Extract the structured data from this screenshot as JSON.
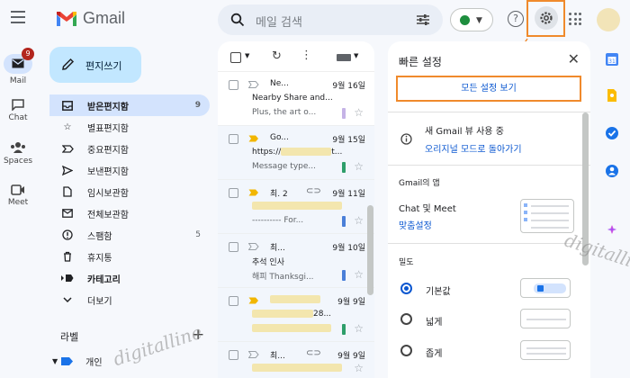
{
  "header": {
    "app_name": "Gmail",
    "search_placeholder": "메일 검색"
  },
  "rail": {
    "mail_label": "Mail",
    "mail_badge": "9",
    "chat_label": "Chat",
    "spaces_label": "Spaces",
    "meet_label": "Meet"
  },
  "compose": {
    "label": "편지쓰기"
  },
  "folders": [
    {
      "label": "받은편지함",
      "count": "9",
      "icon": "inbox-icon"
    },
    {
      "label": "별표편지함",
      "count": "",
      "icon": "star-icon"
    },
    {
      "label": "중요편지함",
      "count": "",
      "icon": "important-icon"
    },
    {
      "label": "보낸편지함",
      "count": "",
      "icon": "send-icon"
    },
    {
      "label": "임시보관함",
      "count": "",
      "icon": "draft-icon"
    },
    {
      "label": "전체보관함",
      "count": "",
      "icon": "all-mail-icon"
    },
    {
      "label": "스팸함",
      "count": "5",
      "icon": "spam-icon"
    },
    {
      "label": "휴지통",
      "count": "",
      "icon": "trash-icon"
    },
    {
      "label": "카테고리",
      "count": "",
      "icon": "category-icon"
    },
    {
      "label": "더보기",
      "count": "",
      "icon": "chevron-down-icon"
    }
  ],
  "labels": {
    "heading": "라벨",
    "items": [
      {
        "label": "개인"
      }
    ]
  },
  "mails": [
    {
      "sender": "Ne...",
      "date": "9월 16일",
      "subject": "Nearby Share and...",
      "snippet": "Plus, the art o...",
      "tag_color": "#c5b3e6"
    },
    {
      "sender": "Go...",
      "date": "9월 15일",
      "subject": "https://",
      "subject_tail": "t...",
      "snippet": "Message type...",
      "tag_color": "#2e9e6a"
    },
    {
      "sender": "최. 2",
      "date": "9월 11일",
      "subject": "",
      "snippet": "---------- For...",
      "tag_color": "#4a7fd8"
    },
    {
      "sender": "최...",
      "date": "9월 10일",
      "subject": "추석 인사",
      "snippet": "해피 Thanksgi...",
      "tag_color": "#4a7fd8"
    },
    {
      "sender": "",
      "date": "9월 9일",
      "subject": "28...",
      "snippet": "",
      "tag_color": "#2e9e6a"
    },
    {
      "sender": "최...",
      "date": "9월 9일",
      "subject": "",
      "snippet": "",
      "tag_color": ""
    }
  ],
  "quick_settings": {
    "title": "빠른 설정",
    "all_settings": "모든 설정 보기",
    "new_view": "새 Gmail 뷰 사용 중",
    "revert_link": "오리지널 모드로 돌아가기",
    "apps_heading": "Gmail의 앱",
    "chat_meet": "Chat 및 Meet",
    "customize": "맞춤설정",
    "density_heading": "밀도",
    "density_options": [
      {
        "label": "기본값",
        "selected": true
      },
      {
        "label": "넓게",
        "selected": false
      },
      {
        "label": "좁게",
        "selected": false
      }
    ]
  },
  "watermarks": [
    "digitalline",
    "digitallin"
  ],
  "colors": {
    "accent": "#0b57d0",
    "highlight_box": "#f08a2c",
    "nav_active": "#d3e3fd",
    "compose": "#c2e7ff"
  }
}
